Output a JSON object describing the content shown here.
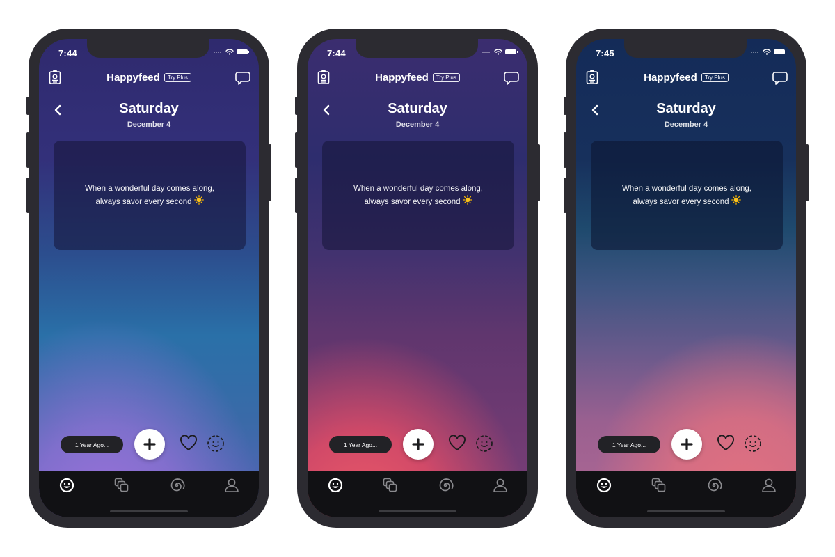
{
  "app": {
    "name": "Happyfeed"
  },
  "phones": [
    {
      "status_bar": {
        "time": "7:44"
      },
      "header": {
        "title": "Happyfeed",
        "plus_badge": "Try Plus",
        "left_icon": "journal-badge-icon",
        "right_icon": "chat-bubble-icon"
      },
      "day": {
        "weekday": "Saturday",
        "date": "December 4"
      },
      "quote": {
        "line1": "When a wonderful day comes along,",
        "line2": "always savor every second",
        "emoji": "sun-icon"
      },
      "actions": {
        "memory_button": "1 Year Ago...",
        "add_icon": "plus-icon",
        "favorite_icon": "heart-icon",
        "mood_icon": "mood-face-icon"
      },
      "tabs": [
        {
          "name": "feed",
          "icon": "smiley-icon",
          "active": true
        },
        {
          "name": "moments",
          "icon": "stacked-photos-icon",
          "active": false
        },
        {
          "name": "spiral",
          "icon": "spiral-icon",
          "active": false
        },
        {
          "name": "profile",
          "icon": "person-icon",
          "active": false
        }
      ],
      "theme": {
        "gradient": "blue-purple",
        "colors": [
          "#2f2a6e",
          "#2a70a8",
          "#9a72da"
        ]
      }
    },
    {
      "status_bar": {
        "time": "7:44"
      },
      "header": {
        "title": "Happyfeed",
        "plus_badge": "Try Plus",
        "left_icon": "journal-badge-icon",
        "right_icon": "chat-bubble-icon"
      },
      "day": {
        "weekday": "Saturday",
        "date": "December 4"
      },
      "quote": {
        "line1": "When a wonderful day comes along,",
        "line2": "always savor every second",
        "emoji": "sun-icon"
      },
      "actions": {
        "memory_button": "1 Year Ago...",
        "add_icon": "plus-icon",
        "favorite_icon": "heart-icon",
        "mood_icon": "mood-face-icon"
      },
      "tabs": [
        {
          "name": "feed",
          "icon": "smiley-icon",
          "active": true
        },
        {
          "name": "moments",
          "icon": "stacked-photos-icon",
          "active": false
        },
        {
          "name": "spiral",
          "icon": "spiral-icon",
          "active": false
        },
        {
          "name": "profile",
          "icon": "person-icon",
          "active": false
        }
      ],
      "theme": {
        "gradient": "purple-coral",
        "colors": [
          "#3b2d6f",
          "#60366e",
          "#ec5a68"
        ]
      }
    },
    {
      "status_bar": {
        "time": "7:45"
      },
      "header": {
        "title": "Happyfeed",
        "plus_badge": "Try Plus",
        "left_icon": "journal-badge-icon",
        "right_icon": "chat-bubble-icon"
      },
      "day": {
        "weekday": "Saturday",
        "date": "December 4"
      },
      "quote": {
        "line1": "When a wonderful day comes along,",
        "line2": "always savor every second",
        "emoji": "sun-icon"
      },
      "actions": {
        "memory_button": "1 Year Ago...",
        "add_icon": "plus-icon",
        "favorite_icon": "heart-icon",
        "mood_icon": "mood-face-icon"
      },
      "tabs": [
        {
          "name": "feed",
          "icon": "smiley-icon",
          "active": true
        },
        {
          "name": "moments",
          "icon": "stacked-photos-icon",
          "active": false
        },
        {
          "name": "spiral",
          "icon": "spiral-icon",
          "active": false
        },
        {
          "name": "profile",
          "icon": "person-icon",
          "active": false
        }
      ],
      "theme": {
        "gradient": "navy-pink",
        "colors": [
          "#142b58",
          "#6b5a8c",
          "#e07080"
        ]
      }
    }
  ]
}
